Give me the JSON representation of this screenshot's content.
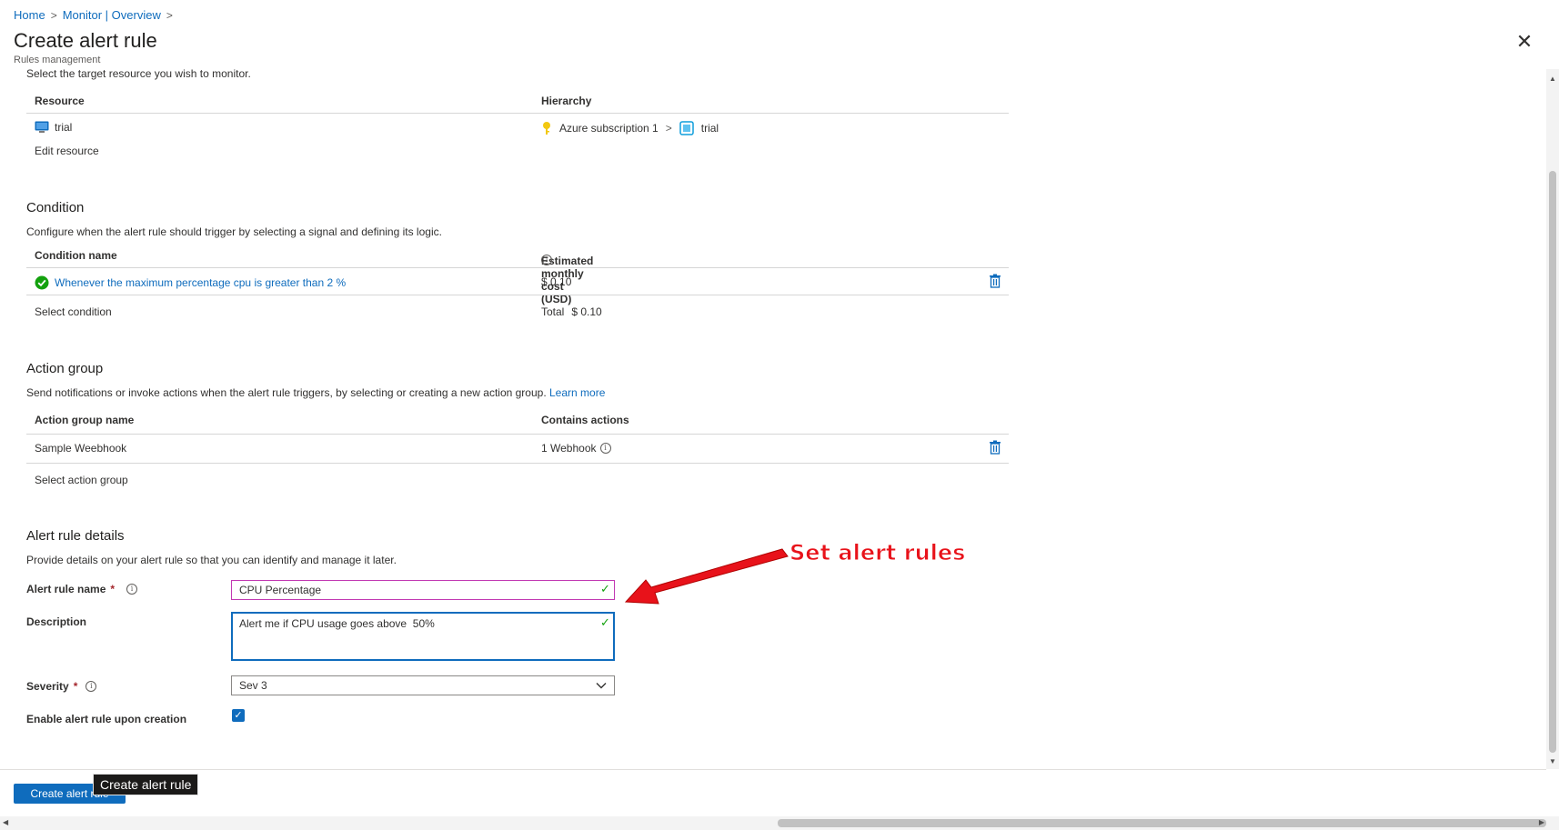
{
  "breadcrumb": {
    "home": "Home",
    "monitor": "Monitor | Overview",
    "sep": ">"
  },
  "header": {
    "title": "Create alert rule",
    "subtitle": "Rules management",
    "close": "✕"
  },
  "scope": {
    "desc": "Select the target resource you wish to monitor.",
    "col_resource": "Resource",
    "col_hierarchy": "Hierarchy",
    "resource_name": "trial",
    "subscription": "Azure subscription 1",
    "resource_group": "trial",
    "edit_link": "Edit resource"
  },
  "condition": {
    "title": "Condition",
    "desc": "Configure when the alert rule should trigger by selecting a signal and defining its logic.",
    "col_name": "Condition name",
    "col_cost": "Estimated monthly cost (USD)",
    "row_name": "Whenever the maximum percentage cpu is greater than 2 %",
    "row_cost": "$ 0.10",
    "select_link": "Select condition",
    "total_label": "Total",
    "total_value": "$ 0.10"
  },
  "action_group": {
    "title": "Action group",
    "desc": "Send notifications or invoke actions when the alert rule triggers, by selecting or creating a new action group.",
    "learn_more": "Learn more",
    "col_name": "Action group name",
    "col_actions": "Contains actions",
    "row_name": "Sample Weebhook",
    "row_actions": "1 Webhook",
    "select_link": "Select action group"
  },
  "details": {
    "title": "Alert rule details",
    "desc": "Provide details on your alert rule so that you can identify and manage it later.",
    "name_label": "Alert rule name",
    "name_value": "CPU Percentage",
    "description_label": "Description",
    "description_value": "Alert me if CPU usage goes above  50%",
    "severity_label": "Severity",
    "severity_value": "Sev 3",
    "enable_label": "Enable alert rule upon creation",
    "required_mark": "*"
  },
  "footer": {
    "create_button": "Create alert rule",
    "tooltip": "Create alert rule"
  },
  "annotation": {
    "text": "Set alert rules",
    "color": "#e8121a"
  },
  "colors": {
    "accent": "#0f6cbd",
    "success": "#13a10e",
    "danger": "#a4262c"
  }
}
